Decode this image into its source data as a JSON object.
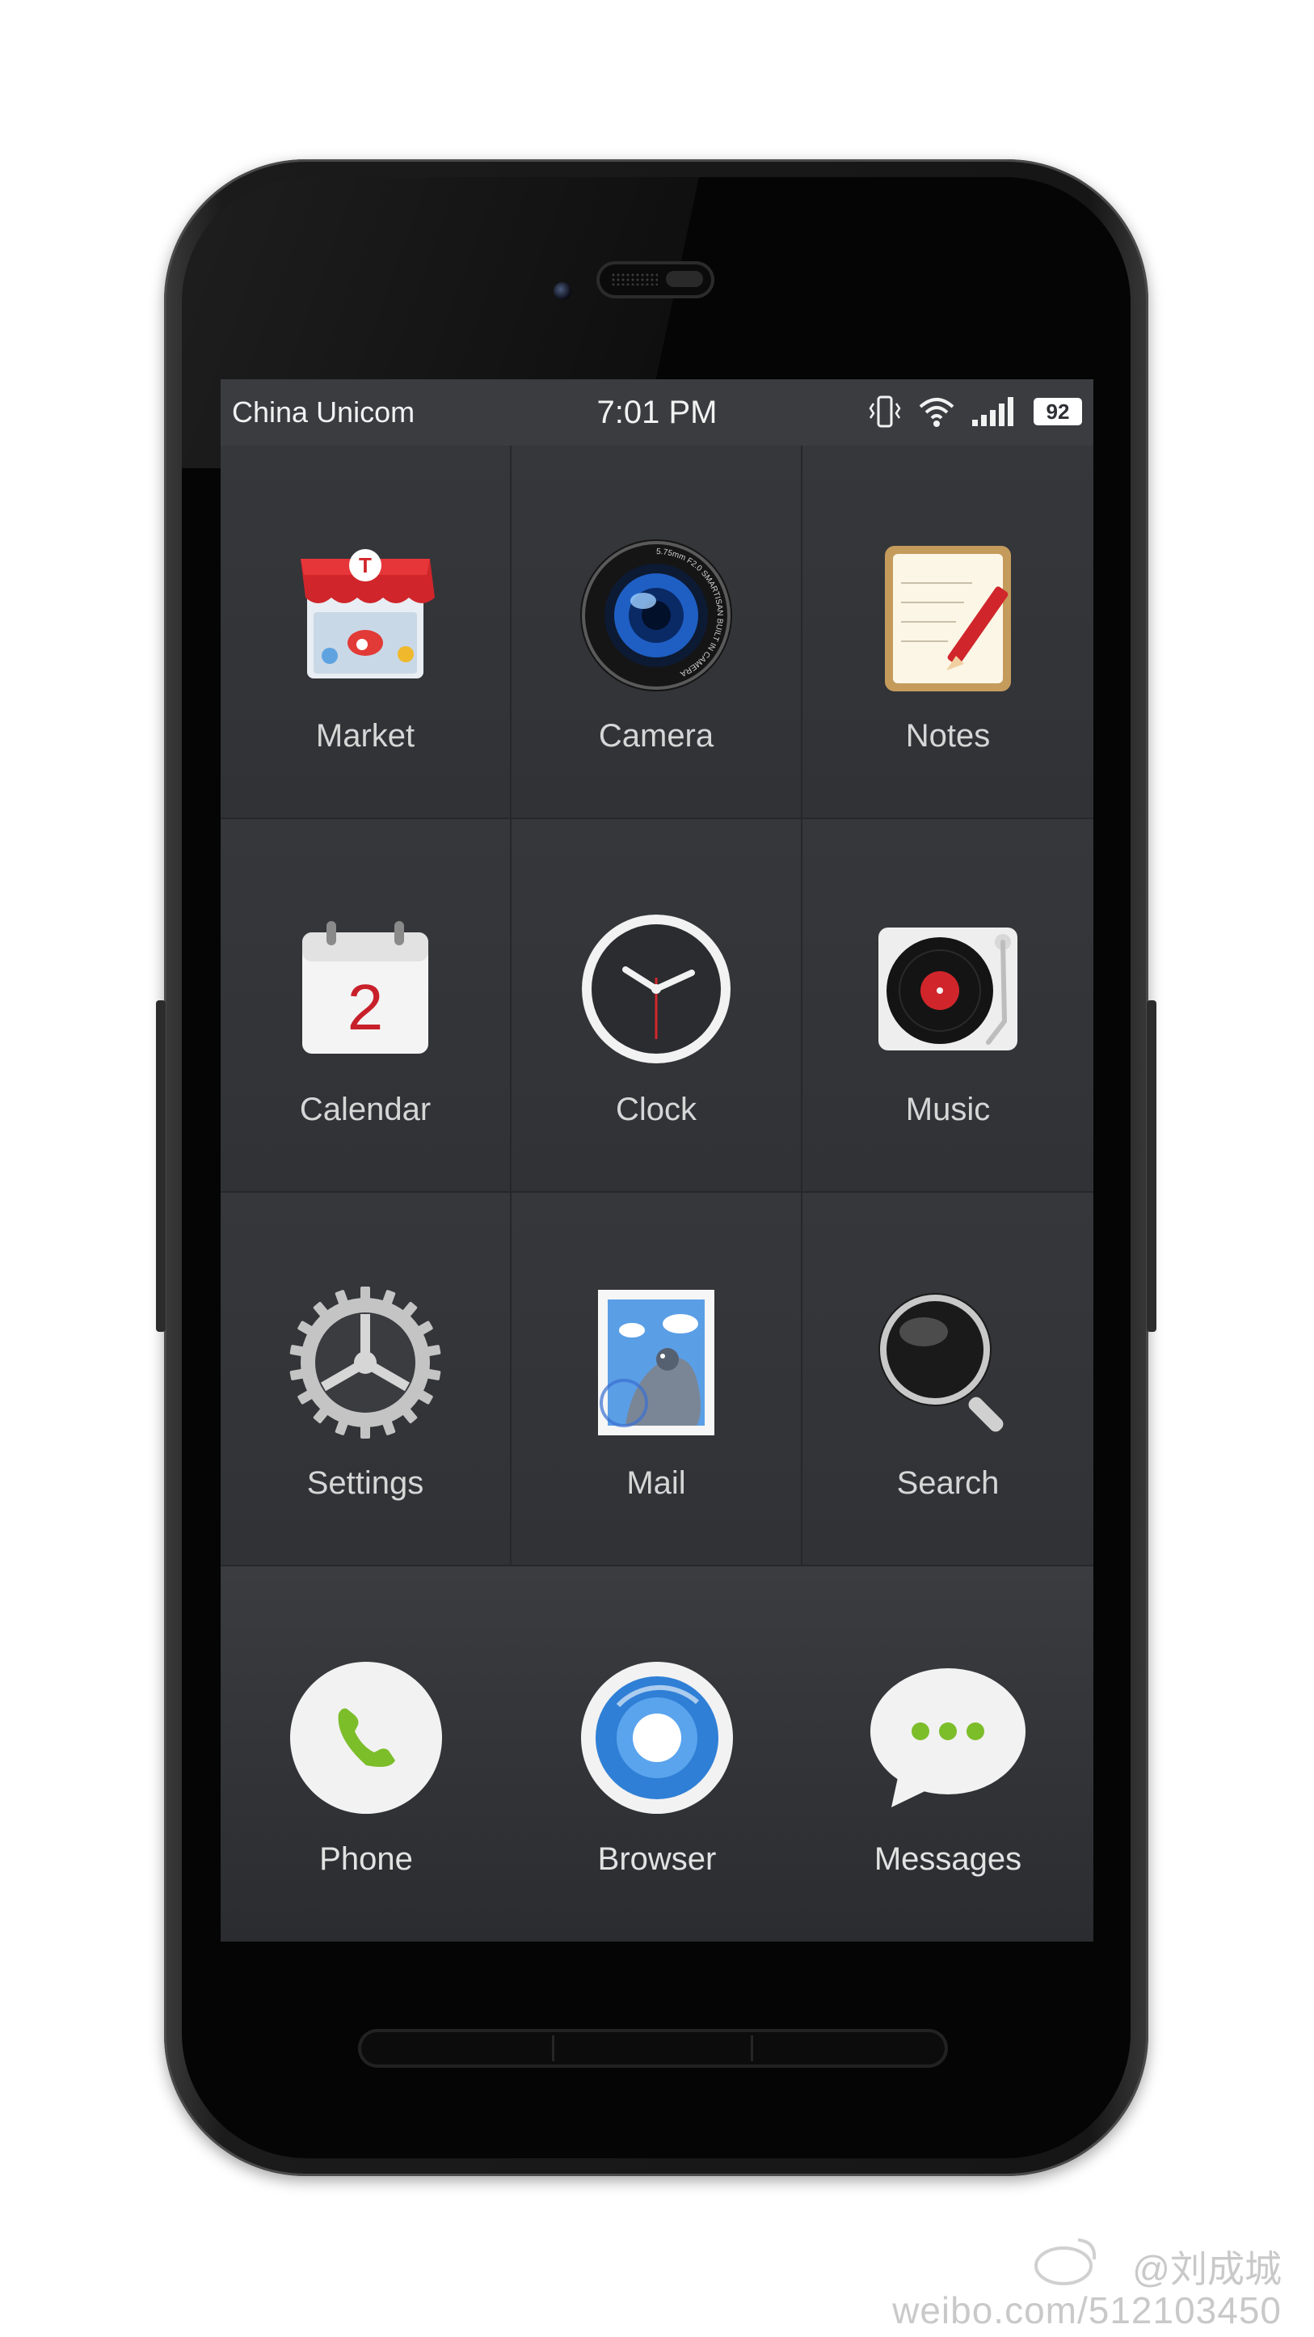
{
  "status_bar": {
    "carrier": "China Unicom",
    "time": "7:01 PM",
    "battery": "92",
    "icons": [
      "vibrate-icon",
      "wifi-icon",
      "signal-icon",
      "battery-icon"
    ]
  },
  "apps": [
    {
      "label": "Market",
      "icon": "market-icon"
    },
    {
      "label": "Camera",
      "icon": "camera-icon"
    },
    {
      "label": "Notes",
      "icon": "notes-icon"
    },
    {
      "label": "Calendar",
      "icon": "calendar-icon",
      "calendar_day": "2"
    },
    {
      "label": "Clock",
      "icon": "clock-icon"
    },
    {
      "label": "Music",
      "icon": "music-icon"
    },
    {
      "label": "Settings",
      "icon": "settings-icon"
    },
    {
      "label": "Mail",
      "icon": "mail-icon"
    },
    {
      "label": "Search",
      "icon": "search-icon"
    }
  ],
  "dock": [
    {
      "label": "Phone",
      "icon": "phone-icon"
    },
    {
      "label": "Browser",
      "icon": "browser-icon"
    },
    {
      "label": "Messages",
      "icon": "messages-icon"
    }
  ],
  "market_badge": "T",
  "camera_ring_text": "5.75mm F2.0 SMARTISAN BUILT IN CAMERA",
  "watermark": {
    "handle": "@刘成城",
    "url": "weibo.com/512103450"
  },
  "colors": {
    "screen_bg": "#2e3034",
    "status_bar_bg": "#3a3c40",
    "label_text": "#d6d6d6",
    "accent_red": "#d0262b",
    "accent_green": "#7cbd2a",
    "accent_blue": "#2f7fd6"
  }
}
